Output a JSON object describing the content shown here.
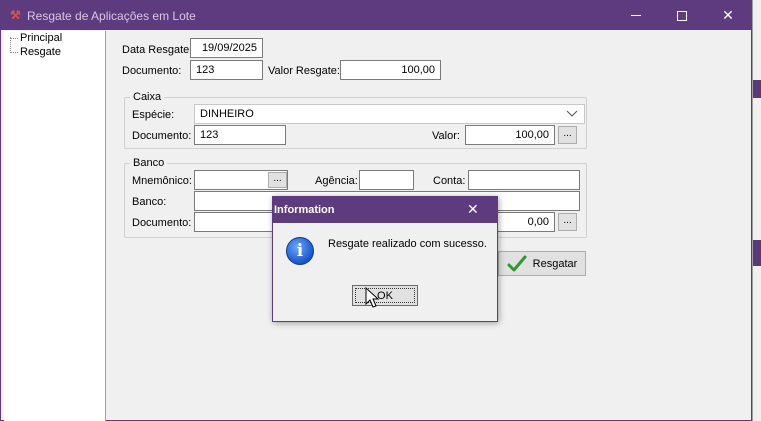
{
  "window": {
    "title": "Resgate de Aplicações em Lote",
    "min_icon": "minimize-icon",
    "max_icon": "maximize-icon",
    "close_icon": "close-icon",
    "titlebar_color": "#5e3b7f"
  },
  "tree": {
    "items": [
      {
        "label": "Principal"
      },
      {
        "label": "Resgate"
      }
    ]
  },
  "header_fields": {
    "data_resgate_label": "Data Resgate:",
    "data_resgate_value": "19/09/2025",
    "documento_label": "Documento:",
    "documento_value": "123",
    "valor_resgate_label": "Valor Resgate:",
    "valor_resgate_value": "100,00"
  },
  "caixa": {
    "title": "Caixa",
    "especie_label": "Espécie:",
    "especie_value": "DINHEIRO",
    "documento_label": "Documento:",
    "documento_value": "123",
    "valor_label": "Valor:",
    "valor_value": "100,00",
    "ellipsis": "..."
  },
  "banco": {
    "title": "Banco",
    "mnemonico_label": "Mnemônico:",
    "mnemonico_value": "",
    "agencia_label": "Agência:",
    "agencia_value": "",
    "conta_label": "Conta:",
    "conta_value": "",
    "banco_label": "Banco:",
    "banco_value": "",
    "documento_label": "Documento:",
    "documento_value": "",
    "valor_value": "0,00",
    "ellipsis": "..."
  },
  "actions": {
    "resgatar_label": "Resgatar"
  },
  "dialog": {
    "title": "Information",
    "close_glyph": "✕",
    "icon_glyph": "i",
    "message": "Resgate realizado com sucesso.",
    "ok_label": "OK"
  }
}
